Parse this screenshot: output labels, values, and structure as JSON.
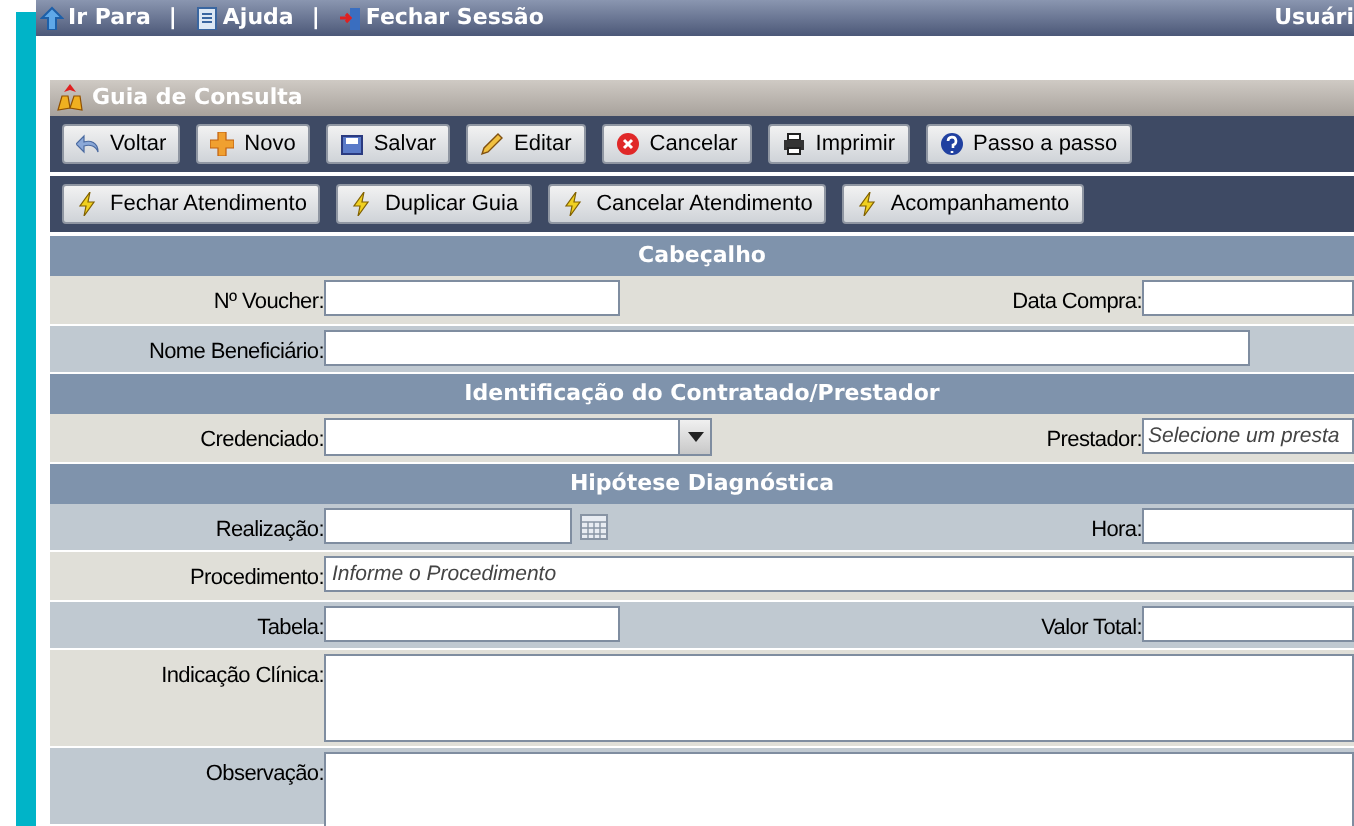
{
  "topbar": {
    "links": [
      {
        "label": "Ir Para"
      },
      {
        "label": "Ajuda"
      },
      {
        "label": "Fechar Sessão"
      }
    ],
    "separators": [
      "|",
      "|"
    ],
    "user": "Usuári"
  },
  "panel": {
    "title": "Guia de Consulta"
  },
  "toolbar": [
    [
      "Voltar",
      "Novo",
      "Salvar",
      "Editar",
      "Cancelar",
      "Imprimir",
      "Passo a passo"
    ],
    [
      "Fechar Atendimento",
      "Duplicar Guia",
      "Cancelar Atendimento",
      "Acompanhamento"
    ]
  ],
  "form": [
    {
      "kind": "section",
      "title": "Cabeçalho"
    },
    {
      "kind": "row",
      "fields": [
        {
          "label": "Nº Voucher:",
          "kind": "short"
        },
        {
          "label": "Data Compra:",
          "kind": "edge"
        }
      ]
    },
    {
      "kind": "row",
      "fields": [
        {
          "label": "Nome Beneficiário:",
          "kind": "long"
        }
      ]
    },
    {
      "kind": "section",
      "title": "Identificação do Contratado/Prestador"
    },
    {
      "kind": "row",
      "fields": [
        {
          "label": "Credenciado:",
          "kind": "select"
        },
        {
          "label": "Prestador:",
          "kind": "edge",
          "placeholder": "Selecione um presta"
        }
      ]
    },
    {
      "kind": "section",
      "title": "Hipótese Diagnóstica"
    },
    {
      "kind": "row",
      "fields": [
        {
          "label": "Realização:",
          "kind": "date"
        },
        {
          "label": "Hora:",
          "kind": "edge"
        }
      ]
    },
    {
      "kind": "row",
      "fields": [
        {
          "label": "Procedimento:",
          "kind": "full",
          "placeholder": "Informe o Procedimento"
        }
      ]
    },
    {
      "kind": "row",
      "fields": [
        {
          "label": "Tabela:",
          "kind": "short"
        },
        {
          "label": "Valor Total:",
          "kind": "edge"
        }
      ]
    },
    {
      "kind": "row",
      "fields": [
        {
          "label": "Indicação Clínica:",
          "kind": "area"
        }
      ]
    },
    {
      "kind": "row",
      "fields": [
        {
          "label": "Observação:",
          "kind": "area"
        }
      ]
    }
  ]
}
